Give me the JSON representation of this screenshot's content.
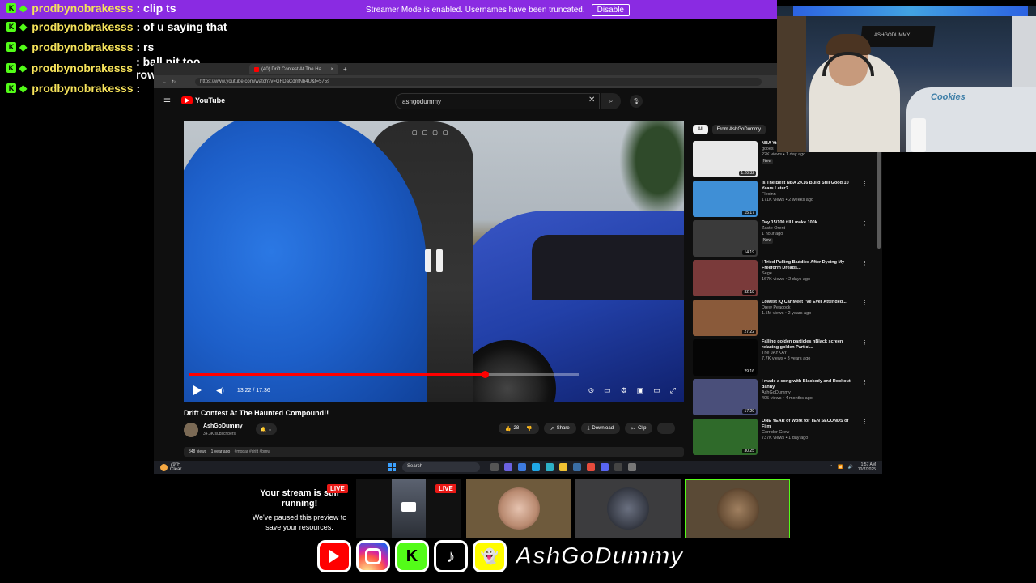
{
  "banner": {
    "message": "Streamer Mode is enabled. Usernames have been truncated.",
    "disable_label": "Disable"
  },
  "chat": {
    "messages": [
      {
        "user": "prodbynobrakesss",
        "text": ": clip ts"
      },
      {
        "user": "prodbynobrakesss",
        "text": ": of u saying that"
      },
      {
        "user": "prodbynobrakesss",
        "text": ": rs"
      },
      {
        "user": "prodbynobrakesss",
        "text": ": ball pit too rowdy"
      },
      {
        "user": "prodbynobrakesss",
        "text": ":"
      }
    ],
    "user_color": "#f5e25a",
    "badge_color": "#53fc18"
  },
  "browser": {
    "tab_title": "(40) Drift Contest At The Ha",
    "tab_close": "×",
    "new_tab": "+",
    "url": "https://www.youtube.com/watch?v=GFDaCdmNb4U&t=575s"
  },
  "youtube": {
    "logo_text": "YouTube",
    "search_value": "ashgodummy",
    "search_clear": "✕",
    "video": {
      "time": "13:22 / 17:36",
      "progress": 0.76,
      "title": "Drift Contest At The Haunted Compound!!",
      "channel": "AshGoDummy",
      "subscribers": "34.3K subscribers",
      "views": "348 views",
      "age": "1 year ago",
      "tags": "#mopar #drift #bmw",
      "likes": "28",
      "share_label": "Share",
      "download_label": "Download",
      "clip_label": "Clip",
      "more": "···"
    },
    "chips": [
      "All",
      "From AshGoDummy"
    ],
    "recommendations": [
      {
        "title": "NBA Yt Baltimore, MD [FULL SET |...",
        "channel": "gcoes",
        "stats": "22K views • 1 day ago",
        "badge": "New",
        "duration": "1:20:32",
        "thumb": "#e8e8e8"
      },
      {
        "title": "Is The Best NBA 2K16 Build Still Good 10 Years Later?",
        "channel": "Flexinn",
        "stats": "171K views • 2 weeks ago",
        "badge": "",
        "duration": "15:17",
        "thumb": "#3f8fd6"
      },
      {
        "title": "Day 15/100 till I make 100k",
        "channel": "Zaste Orent",
        "stats": "1 hour ago",
        "badge": "New",
        "duration": "14:19",
        "thumb": "#3a3a3a"
      },
      {
        "title": "I Tried Pulling Baddies After Dyeing My Freeform Dreads...",
        "channel": "Sege",
        "stats": "167K views • 2 days ago",
        "badge": "",
        "duration": "32:18",
        "thumb": "#7a3a3a"
      },
      {
        "title": "Lowest IQ Car Meet I've Ever Attended...",
        "channel": "Drew Peacock",
        "stats": "1.5M views • 2 years ago",
        "badge": "",
        "duration": "27:22",
        "thumb": "#8a5a3a"
      },
      {
        "title": "Falling golden particles nBlack screen relaxing golden Particl...",
        "channel": "The JAYKAY",
        "stats": "7.7K views • 3 years ago",
        "badge": "",
        "duration": "29:16",
        "thumb": "#050505"
      },
      {
        "title": "I made a song with Blackedy and Rockout danny",
        "channel": "AshGoDummy",
        "stats": "405 views • 4 months ago",
        "badge": "",
        "duration": "17:29",
        "thumb": "#4a4f7a"
      },
      {
        "title": "ONE YEAR of Work for TEN SECONDS of Film",
        "channel": "Corridor Crew",
        "stats": "737K views • 1 day ago",
        "badge": "",
        "duration": "30:25",
        "thumb": "#2f6a2a"
      }
    ]
  },
  "taskbar": {
    "weather_temp": "79°F",
    "weather_text": "Clear",
    "search_label": "Search",
    "time": "1:57 AM",
    "date": "10/7/2025"
  },
  "webcam": {
    "flag_label": "ASHGODUMMY",
    "bed_text": "Cookies"
  },
  "preview": {
    "title": "Your stream is still running!",
    "subtitle": "We've paused this preview to save your resources.",
    "live_label": "LIVE"
  },
  "social": {
    "handle": "AshGoDummy",
    "kick_letter": "K",
    "tiktok_glyph": "♪",
    "snap_glyph": "👻"
  }
}
